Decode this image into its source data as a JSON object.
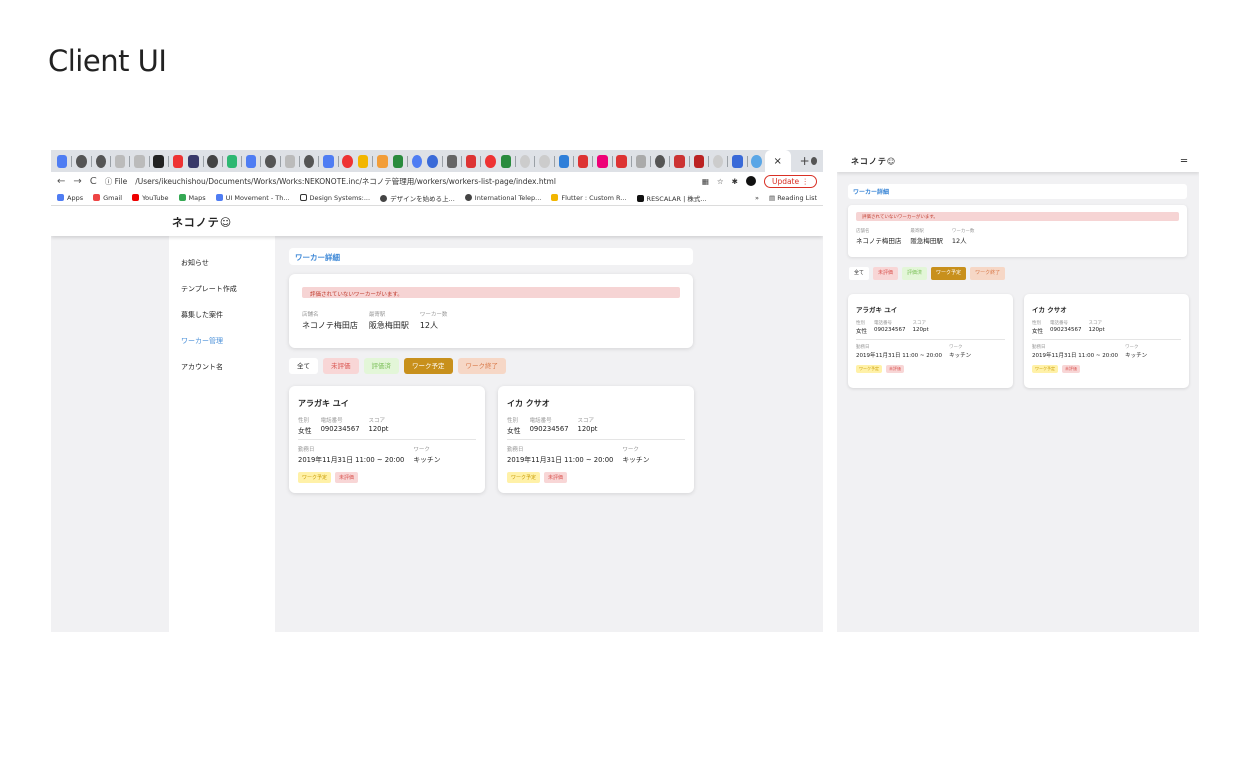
{
  "page": {
    "title": "Client UI"
  },
  "browser": {
    "tab_close": "×",
    "tab_plus": "+",
    "nav_back": "←",
    "nav_forward": "→",
    "nav_reload": "C",
    "file_label": "ⓘ File",
    "url": "/Users/ikeuchishou/Documents/Works/Works:NEKONOTE.inc/ネコノテ管理用/workers/workers-list-page/index.html",
    "update_label": "Update ⋮",
    "bookmarks": [
      "Apps",
      "Gmail",
      "YouTube",
      "Maps",
      "UI Movement - Th...",
      "Design Systems:...",
      "デザインを始める上...",
      "International Telep...",
      "Flutter : Custom R...",
      "RESCALAR | 株式..."
    ],
    "reading_list": "Reading List",
    "reading_sep": "»"
  },
  "app": {
    "logo": "ネコノテ",
    "sidebar": [
      "お知らせ",
      "テンプレート作成",
      "募集した案件",
      "ワーカー管理",
      "アカウント名"
    ],
    "detail_title": "ワーカー詳細",
    "alert": "評価されていないワーカーがいます。",
    "store": {
      "label": "店舗名",
      "value": "ネコノテ梅田店"
    },
    "station": {
      "label": "最寄駅",
      "value": "阪急梅田駅"
    },
    "workers": {
      "label": "ワーカー数",
      "value": "12人"
    },
    "filters": {
      "all": "全て",
      "unrated": "未評価",
      "rated": "評価済",
      "scheduled": "ワーク予定",
      "done": "ワーク終了"
    },
    "cards": [
      {
        "name": "アラガキ ユイ",
        "gender_label": "性別",
        "gender": "女性",
        "phone_label": "電話番号",
        "phone": "090234567",
        "score_label": "スコア",
        "score": "120pt",
        "date_label": "勤務日",
        "date": "2019年11月31日 11:00 ~ 20:00",
        "work_label": "ワーク",
        "work": "キッチン",
        "tag1": "ワーク予定",
        "tag2": "未評価"
      },
      {
        "name": "イカ クサオ",
        "gender_label": "性別",
        "gender": "女性",
        "phone_label": "電話番号",
        "phone": "090234567",
        "score_label": "スコア",
        "score": "120pt",
        "date_label": "勤務日",
        "date": "2019年11月31日 11:00 ~ 20:00",
        "work_label": "ワーク",
        "work": "キッチン",
        "tag1": "ワーク予定",
        "tag2": "未評価"
      }
    ]
  },
  "mobile": {
    "menu_icon": "═"
  }
}
